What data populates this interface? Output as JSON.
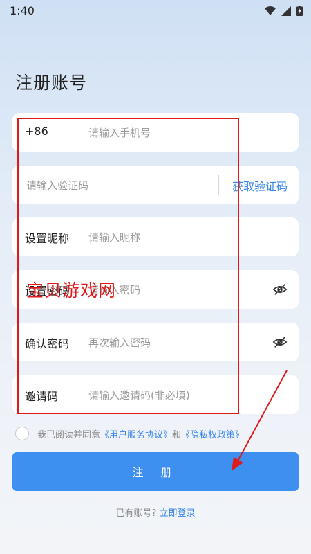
{
  "status_bar": {
    "time": "1:40"
  },
  "title": "注册账号",
  "phone": {
    "prefix": "+86",
    "placeholder": "请输入手机号"
  },
  "code": {
    "placeholder": "请输入验证码",
    "button": "获取验证码"
  },
  "nickname": {
    "label": "设置昵称",
    "placeholder": "请输入昵称"
  },
  "password": {
    "label": "设置密码",
    "placeholder": "请输入密码"
  },
  "confirm_password": {
    "label": "确认密码",
    "placeholder": "再次输入密码"
  },
  "invite": {
    "label": "邀请码",
    "placeholder": "请输入邀请码(非必填)"
  },
  "agreement": {
    "prefix": "我已阅读并同意",
    "user_agreement": "《用户服务协议》",
    "and": "和",
    "privacy_policy": "《隐私权政策》"
  },
  "register_button": "注 册",
  "login": {
    "prompt": "已有账号?",
    "link": "立即登录"
  },
  "watermark": "宝贝游戏网",
  "colors": {
    "accent": "#3d8ff0",
    "link": "#3a86e8",
    "annotation": "#e0191b"
  }
}
